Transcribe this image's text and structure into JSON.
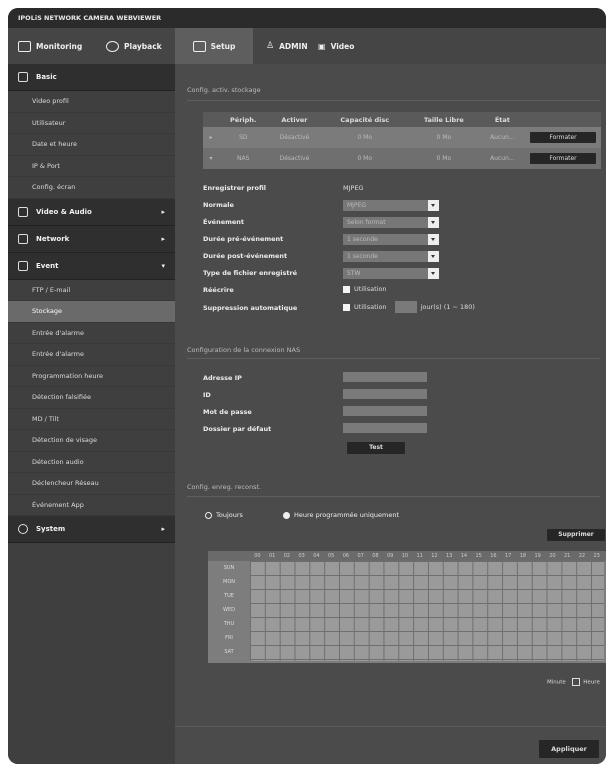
{
  "window": {
    "title": "IPOLiS NETWORK CAMERA WEBVIEWER"
  },
  "topnav": {
    "items": [
      {
        "label": "Monitoring",
        "icon": "monitor-icon"
      },
      {
        "label": "Playback",
        "icon": "playback-icon"
      },
      {
        "label": "Setup",
        "icon": "setup-icon",
        "active": true
      }
    ],
    "admin_label": "ADMIN",
    "video_label": "Video"
  },
  "sidebar": {
    "basic": "Basic",
    "basic_items": [
      "Video profil",
      "Utilisateur",
      "Date et heure",
      "IP & Port",
      "Config. écran"
    ],
    "video_audio": "Video & Audio",
    "network": "Network",
    "event": "Event",
    "event_items": [
      "FTP / E-mail",
      "Stockage",
      "Entrée d'alarme",
      "Entrée d'alarme",
      "Programmation heure",
      "Détection falsifiée",
      "MD / Tilt",
      "Détection de visage",
      "Détection audio",
      "Déclencheur Réseau",
      "Événement App"
    ],
    "system": "System"
  },
  "storage_section": {
    "title": "Config. activ. stockage",
    "columns": [
      "Périph.",
      "Activer",
      "Capacité disc",
      "Taille Libre",
      "État",
      ""
    ],
    "rows": [
      {
        "device": "SD",
        "enable": "Désactivé",
        "capacity": "0 Mo",
        "free": "0 Mo",
        "status": "Aucun...",
        "action": "Formater"
      },
      {
        "device": "NAS",
        "enable": "Désactivé",
        "capacity": "0 Mo",
        "free": "0 Mo",
        "status": "Aucun...",
        "action": "Formater"
      }
    ]
  },
  "settings": {
    "profile_label": "Enregistrer profil",
    "profile_value": "MJPEG",
    "normal_label": "Normale",
    "normal_value": "MJPEG",
    "event_label": "Événement",
    "event_value": "Selon format",
    "pre_label": "Durée pré-événement",
    "pre_value": "1 seconde",
    "post_label": "Durée post-événement",
    "post_value": "1 seconde",
    "type_label": "Type de fichier enregistré",
    "type_value": "STW",
    "overwrite_label": "Réécrire",
    "overwrite_value": "Utilisation",
    "autodelete_label": "Suppression automatique",
    "autodelete_value": "Utilisation",
    "autodelete_suffix": "jour(s) (1 ~ 180)"
  },
  "nas_section": {
    "title": "Configuration de la connexion NAS",
    "fields": [
      "Adresse IP",
      "ID",
      "Mot de passe",
      "Dossier par défaut"
    ],
    "test_button": "Test"
  },
  "schedule": {
    "title": "Config. enreg. reconst.",
    "option_always": "Toujours",
    "option_schedule": "Heure programmée uniquement",
    "delete_button": "Supprimer",
    "hours": [
      "00",
      "01",
      "02",
      "03",
      "04",
      "05",
      "06",
      "07",
      "08",
      "09",
      "10",
      "11",
      "12",
      "13",
      "14",
      "15",
      "16",
      "17",
      "18",
      "19",
      "20",
      "21",
      "22",
      "23"
    ],
    "days": [
      "SUN",
      "MON",
      "TUE",
      "WED",
      "THU",
      "FRI",
      "SAT"
    ],
    "minute_label": "Minute",
    "hour_label": "Heure"
  },
  "apply_button": "Appliquer"
}
